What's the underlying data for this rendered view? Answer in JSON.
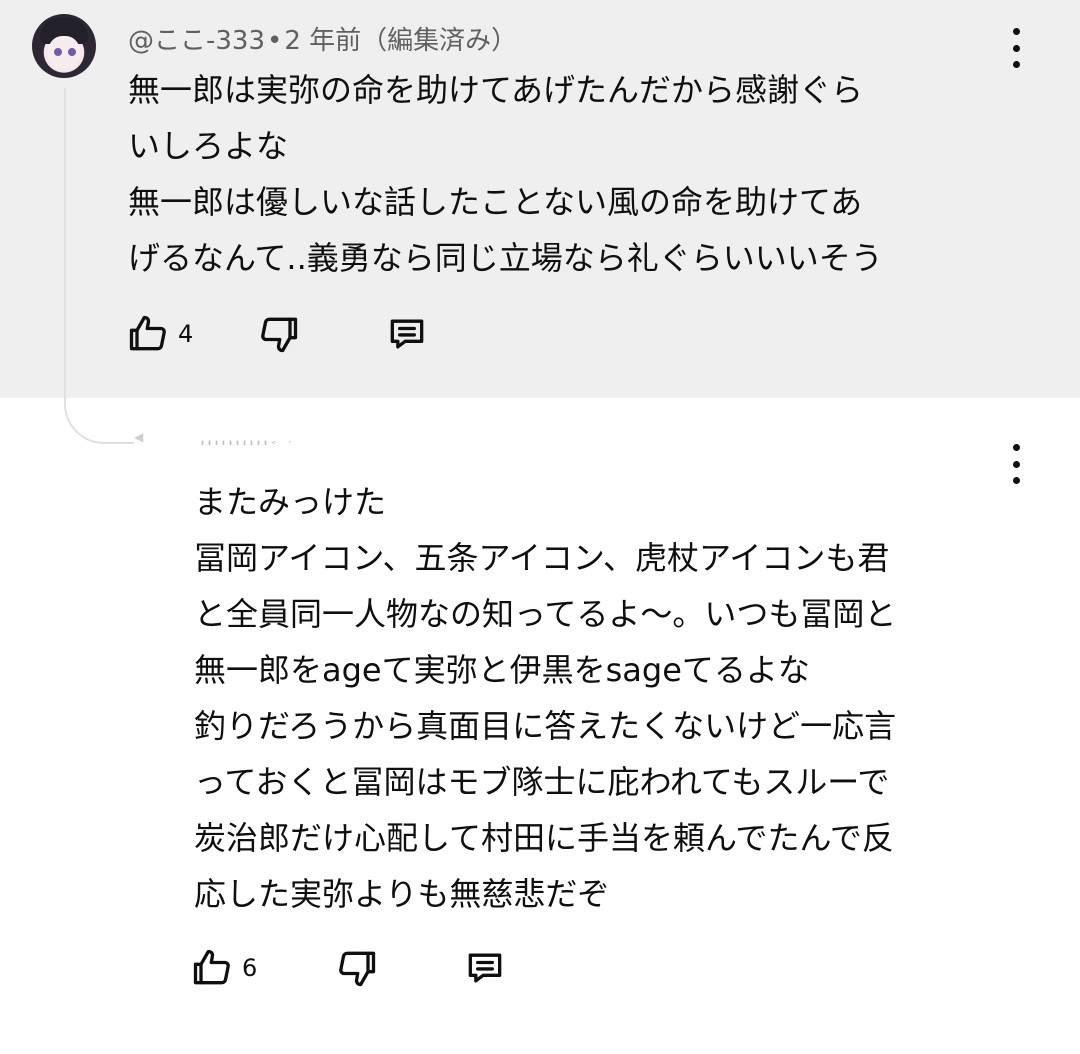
{
  "comment": {
    "username": "@ここ-333",
    "separator": "•",
    "time": "2 年前（編集済み）",
    "lines": [
      "無一郎は実弥の命を助けてあげたんだから感謝ぐら",
      "いしろよな",
      "無一郎は優しいな話したことない風の命を助けてあ",
      "げるなんて..義勇なら同じ立場なら礼ぐらいいいそう"
    ],
    "like_count": "4"
  },
  "reply": {
    "username_faded": "ıııııııııı‹ ·",
    "lines": [
      "またみっけた",
      "冨岡アイコン、五条アイコン、虎杖アイコンも君",
      "と全員同一人物なの知ってるよ〜。いつも冨岡と",
      "無一郎をageて実弥と伊黒をsageてるよな",
      "釣りだろうから真面目に答えたくないけど一応言",
      "っておくと冨岡はモブ隊士に庇われてもスルーで",
      "炭治郎だけ心配して村田に手当を頼んでたんで反",
      "応した実弥よりも無慈悲だぞ"
    ],
    "like_count": "6"
  },
  "icons": {
    "like": "thumbs-up-icon",
    "dislike": "thumbs-down-icon",
    "reply": "comment-reply-icon",
    "more": "more-vertical-icon"
  },
  "colors": {
    "highlight_bg": "#efefef",
    "text": "#0f0f0f",
    "meta": "#606060"
  }
}
